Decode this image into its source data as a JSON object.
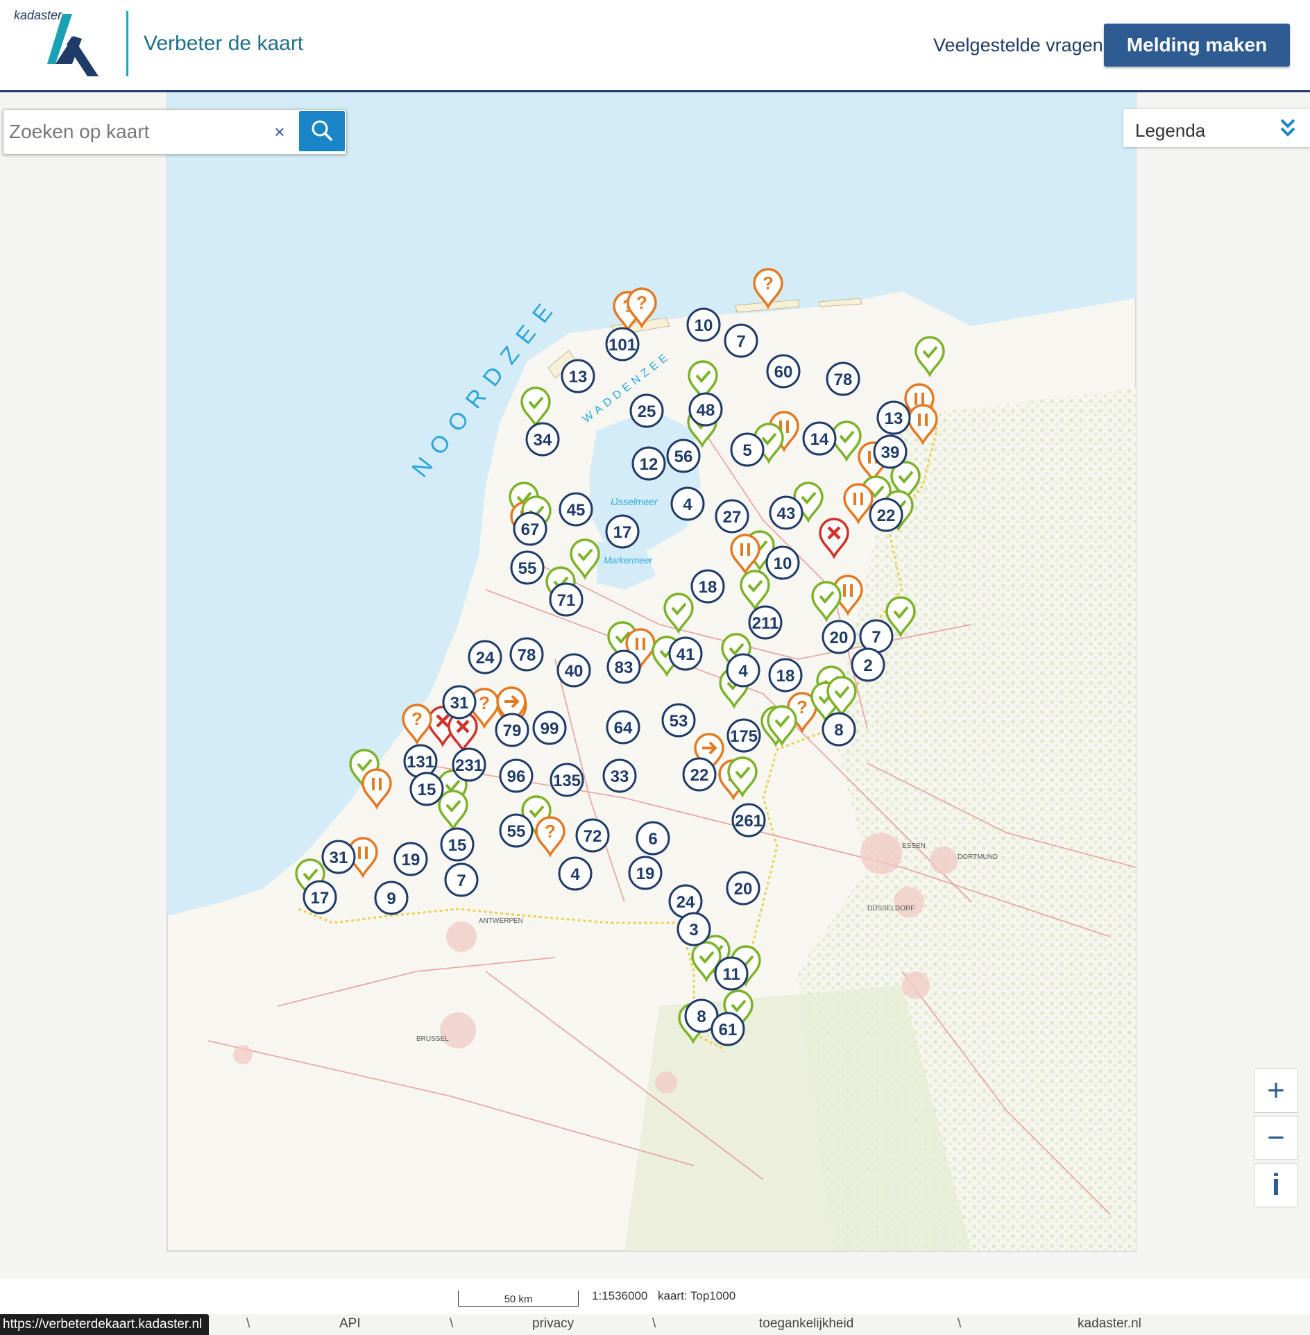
{
  "header": {
    "brand": "kadaster",
    "title": "Verbeter de kaart",
    "faq_label": "Veelgestelde vragen",
    "report_label": "Melding maken"
  },
  "search": {
    "placeholder": "Zoeken op kaart",
    "value": "",
    "clear_label": "×"
  },
  "legend": {
    "label": "Legenda"
  },
  "map_labels": {
    "sea": "NOORDZEE",
    "wadden": "WADDENZEE",
    "ijsselmeer": "IJsselmeer",
    "markermeer": "Markermeer",
    "antwerpen": "ANTWERPEN",
    "brussel": "BRUSSEL",
    "duesseldorf": "DÜSSELDORF",
    "dortmund": "DORTMUND",
    "essen": "ESSEN"
  },
  "colors": {
    "brand": "#1f3b68",
    "cluster_ring": "#1f3b68",
    "marker_done": "#7db32a",
    "marker_question": "#e37a24",
    "marker_paused": "#e37a24",
    "marker_rejected": "#d2312a",
    "sea": "#d4ecf7",
    "land": "#f6f5ef"
  },
  "clusters": [
    {
      "count": "101"
    },
    {
      "count": "10"
    },
    {
      "count": "7"
    },
    {
      "count": "13"
    },
    {
      "count": "60"
    },
    {
      "count": "78"
    },
    {
      "count": "34"
    },
    {
      "count": "25"
    },
    {
      "count": "48"
    },
    {
      "count": "13"
    },
    {
      "count": "14"
    },
    {
      "count": "5"
    },
    {
      "count": "39"
    },
    {
      "count": "12"
    },
    {
      "count": "56"
    },
    {
      "count": "45"
    },
    {
      "count": "4"
    },
    {
      "count": "27"
    },
    {
      "count": "43"
    },
    {
      "count": "22"
    },
    {
      "count": "67"
    },
    {
      "count": "17"
    },
    {
      "count": "55"
    },
    {
      "count": "10"
    },
    {
      "count": "18"
    },
    {
      "count": "71"
    },
    {
      "count": "211"
    },
    {
      "count": "20"
    },
    {
      "count": "7"
    },
    {
      "count": "24"
    },
    {
      "count": "78"
    },
    {
      "count": "41"
    },
    {
      "count": "40"
    },
    {
      "count": "83"
    },
    {
      "count": "4"
    },
    {
      "count": "18"
    },
    {
      "count": "2"
    },
    {
      "count": "31"
    },
    {
      "count": "53"
    },
    {
      "count": "79"
    },
    {
      "count": "99"
    },
    {
      "count": "64"
    },
    {
      "count": "175"
    },
    {
      "count": "8"
    },
    {
      "count": "131"
    },
    {
      "count": "231"
    },
    {
      "count": "96"
    },
    {
      "count": "135"
    },
    {
      "count": "33"
    },
    {
      "count": "22"
    },
    {
      "count": "15"
    },
    {
      "count": "261"
    },
    {
      "count": "55"
    },
    {
      "count": "72"
    },
    {
      "count": "6"
    },
    {
      "count": "15"
    },
    {
      "count": "31"
    },
    {
      "count": "19"
    },
    {
      "count": "4"
    },
    {
      "count": "19"
    },
    {
      "count": "7"
    },
    {
      "count": "20"
    },
    {
      "count": "17"
    },
    {
      "count": "9"
    },
    {
      "count": "24"
    },
    {
      "count": "3"
    },
    {
      "count": "11"
    },
    {
      "count": "8"
    },
    {
      "count": "61"
    }
  ],
  "markers": [
    {
      "type": "question"
    },
    {
      "type": "question"
    },
    {
      "type": "question"
    },
    {
      "type": "done"
    },
    {
      "type": "done"
    },
    {
      "type": "done"
    },
    {
      "type": "done"
    },
    {
      "type": "paused"
    },
    {
      "type": "paused"
    },
    {
      "type": "paused"
    },
    {
      "type": "done"
    },
    {
      "type": "done"
    },
    {
      "type": "paused"
    },
    {
      "type": "done"
    },
    {
      "type": "done"
    },
    {
      "type": "done"
    },
    {
      "type": "paused"
    },
    {
      "type": "done"
    },
    {
      "type": "rejected"
    },
    {
      "type": "done"
    },
    {
      "type": "paused"
    },
    {
      "type": "done"
    },
    {
      "type": "paused"
    },
    {
      "type": "done"
    },
    {
      "type": "done"
    },
    {
      "type": "done"
    },
    {
      "type": "paused"
    },
    {
      "type": "done"
    },
    {
      "type": "done"
    },
    {
      "type": "done"
    },
    {
      "type": "done"
    },
    {
      "type": "done"
    },
    {
      "type": "paused"
    },
    {
      "type": "done"
    },
    {
      "type": "done"
    },
    {
      "type": "question"
    },
    {
      "type": "question"
    },
    {
      "type": "done"
    },
    {
      "type": "done"
    },
    {
      "type": "question"
    },
    {
      "type": "rejected"
    },
    {
      "type": "rejected"
    },
    {
      "type": "arrow"
    },
    {
      "type": "done"
    },
    {
      "type": "done"
    },
    {
      "type": "done"
    },
    {
      "type": "done"
    },
    {
      "type": "done"
    },
    {
      "type": "question"
    },
    {
      "type": "done"
    },
    {
      "type": "arrow"
    },
    {
      "type": "paused"
    },
    {
      "type": "done"
    },
    {
      "type": "paused"
    },
    {
      "type": "done"
    },
    {
      "type": "question"
    },
    {
      "type": "done"
    },
    {
      "type": "paused"
    },
    {
      "type": "done"
    },
    {
      "type": "done"
    },
    {
      "type": "done"
    },
    {
      "type": "done"
    },
    {
      "type": "done"
    },
    {
      "type": "done"
    }
  ],
  "map_footer": {
    "scale_label": "50 km",
    "scale_ratio": "1:1536000",
    "map_source": "kaart: Top1000"
  },
  "footer": {
    "status_url": "https://verbeterdekaart.kadaster.nl",
    "separator": "\\",
    "links": [
      "API",
      "privacy",
      "toegankelijkheid",
      "kadaster.nl"
    ]
  }
}
